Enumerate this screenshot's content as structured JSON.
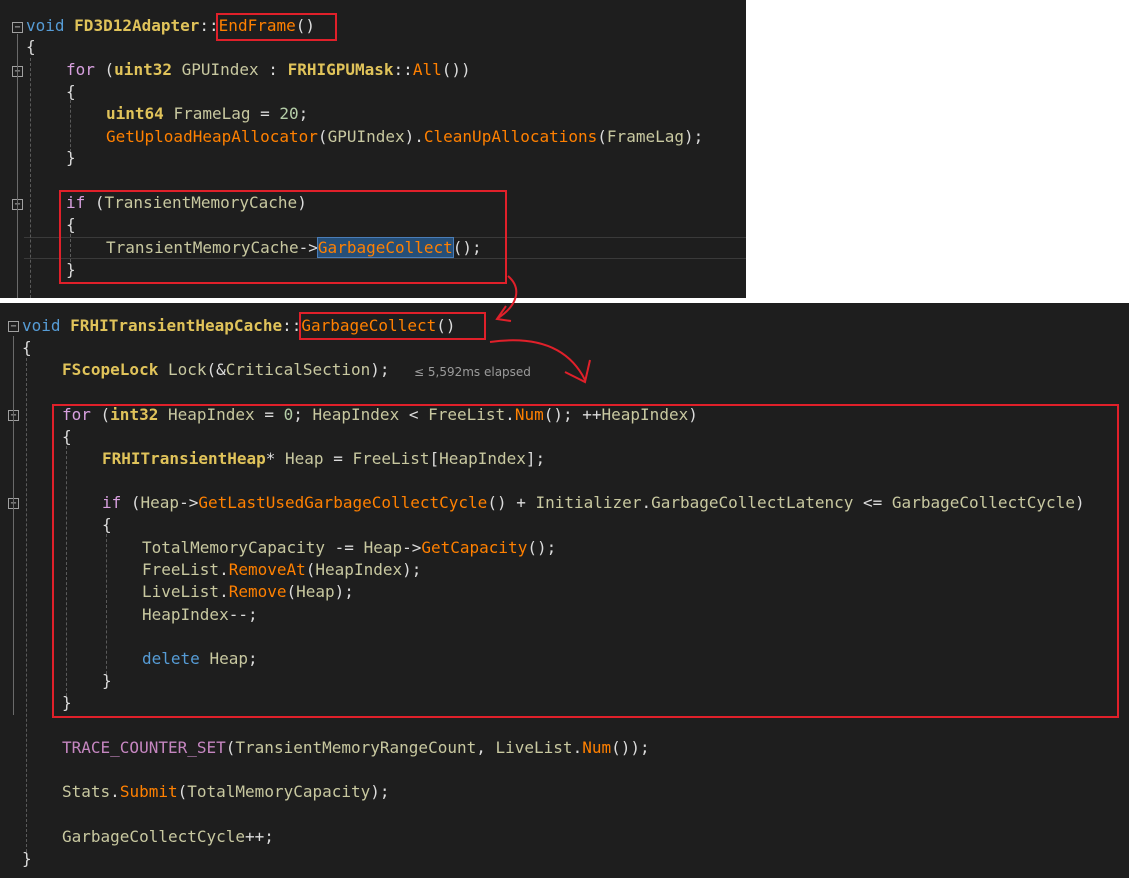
{
  "top": {
    "lines": [
      {
        "parts": [
          [
            "kw",
            "void"
          ],
          [
            "pun",
            " "
          ],
          [
            "ty",
            "FD3D12Adapter"
          ],
          [
            "pun",
            "::"
          ],
          [
            "fn",
            "EndFrame"
          ],
          [
            "pun",
            "()"
          ]
        ]
      },
      {
        "parts": [
          [
            "pun",
            "{"
          ]
        ]
      },
      {
        "parts": [
          [
            "ctl",
            "for"
          ],
          [
            "pun",
            " ("
          ],
          [
            "ty",
            "uint32"
          ],
          [
            "pun",
            " "
          ],
          [
            "var",
            "GPUIndex"
          ],
          [
            "pun",
            " : "
          ],
          [
            "ty",
            "FRHIGPUMask"
          ],
          [
            "pun",
            "::"
          ],
          [
            "fn",
            "All"
          ],
          [
            "pun",
            "())"
          ]
        ]
      },
      {
        "parts": [
          [
            "pun",
            "{"
          ]
        ]
      },
      {
        "parts": [
          [
            "ty",
            "uint64"
          ],
          [
            "pun",
            " "
          ],
          [
            "var",
            "FrameLag"
          ],
          [
            "pun",
            " = "
          ],
          [
            "num",
            "20"
          ],
          [
            "pun",
            ";"
          ]
        ]
      },
      {
        "parts": [
          [
            "fn",
            "GetUploadHeapAllocator"
          ],
          [
            "pun",
            "("
          ],
          [
            "var",
            "GPUIndex"
          ],
          [
            "pun",
            ")."
          ],
          [
            "fn",
            "CleanUpAllocations"
          ],
          [
            "pun",
            "("
          ],
          [
            "var",
            "FrameLag"
          ],
          [
            "pun",
            ");"
          ]
        ]
      },
      {
        "parts": [
          [
            "pun",
            "}"
          ]
        ]
      },
      {
        "parts": []
      },
      {
        "parts": [
          [
            "ctl",
            "if"
          ],
          [
            "pun",
            " ("
          ],
          [
            "var",
            "TransientMemoryCache"
          ],
          [
            "pun",
            ")"
          ]
        ]
      },
      {
        "parts": [
          [
            "pun",
            "{"
          ]
        ]
      },
      {
        "parts": [
          [
            "var",
            "TransientMemoryCache"
          ],
          [
            "pun",
            "->"
          ],
          [
            "fn hl",
            "GarbageCollect"
          ],
          [
            "pun",
            "();"
          ]
        ]
      },
      {
        "parts": [
          [
            "pun",
            "}"
          ]
        ]
      }
    ]
  },
  "bottom": {
    "hint": "≤ 5,592ms elapsed",
    "lines": [
      {
        "parts": [
          [
            "kw",
            "void"
          ],
          [
            "pun",
            " "
          ],
          [
            "ty",
            "FRHITransientHeapCache"
          ],
          [
            "pun",
            "::"
          ],
          [
            "fn",
            "GarbageCollect"
          ],
          [
            "pun",
            "()"
          ]
        ]
      },
      {
        "parts": [
          [
            "pun",
            "{"
          ]
        ]
      },
      {
        "parts": [
          [
            "ty",
            "FScopeLock"
          ],
          [
            "pun",
            " "
          ],
          [
            "var",
            "Lock"
          ],
          [
            "pun",
            "(&"
          ],
          [
            "var",
            "CriticalSection"
          ],
          [
            "pun",
            ");"
          ]
        ]
      },
      {
        "parts": []
      },
      {
        "parts": [
          [
            "ctl",
            "for"
          ],
          [
            "pun",
            " ("
          ],
          [
            "ty",
            "int32"
          ],
          [
            "pun",
            " "
          ],
          [
            "var",
            "HeapIndex"
          ],
          [
            "pun",
            " = "
          ],
          [
            "num",
            "0"
          ],
          [
            "pun",
            "; "
          ],
          [
            "var",
            "HeapIndex"
          ],
          [
            "pun",
            " < "
          ],
          [
            "var",
            "FreeList"
          ],
          [
            "pun",
            "."
          ],
          [
            "fn",
            "Num"
          ],
          [
            "pun",
            "(); ++"
          ],
          [
            "var",
            "HeapIndex"
          ],
          [
            "pun",
            ")"
          ]
        ]
      },
      {
        "parts": [
          [
            "pun",
            "{"
          ]
        ]
      },
      {
        "parts": [
          [
            "ty",
            "FRHITransientHeap"
          ],
          [
            "pun",
            "* "
          ],
          [
            "var",
            "Heap"
          ],
          [
            "pun",
            " = "
          ],
          [
            "var",
            "FreeList"
          ],
          [
            "pun",
            "["
          ],
          [
            "var",
            "HeapIndex"
          ],
          [
            "pun",
            "];"
          ]
        ]
      },
      {
        "parts": []
      },
      {
        "parts": [
          [
            "ctl",
            "if"
          ],
          [
            "pun",
            " ("
          ],
          [
            "var",
            "Heap"
          ],
          [
            "pun",
            "->"
          ],
          [
            "fn",
            "GetLastUsedGarbageCollectCycle"
          ],
          [
            "pun",
            "() + "
          ],
          [
            "var",
            "Initializer"
          ],
          [
            "pun",
            "."
          ],
          [
            "var",
            "GarbageCollectLatency"
          ],
          [
            "pun",
            " <= "
          ],
          [
            "var",
            "GarbageCollectCycle"
          ],
          [
            "pun",
            ")"
          ]
        ]
      },
      {
        "parts": [
          [
            "pun",
            "{"
          ]
        ]
      },
      {
        "parts": [
          [
            "var",
            "TotalMemoryCapacity"
          ],
          [
            "pun",
            " -= "
          ],
          [
            "var",
            "Heap"
          ],
          [
            "pun",
            "->"
          ],
          [
            "fn",
            "GetCapacity"
          ],
          [
            "pun",
            "();"
          ]
        ]
      },
      {
        "parts": [
          [
            "var",
            "FreeList"
          ],
          [
            "pun",
            "."
          ],
          [
            "fn",
            "RemoveAt"
          ],
          [
            "pun",
            "("
          ],
          [
            "var",
            "HeapIndex"
          ],
          [
            "pun",
            ");"
          ]
        ]
      },
      {
        "parts": [
          [
            "var",
            "LiveList"
          ],
          [
            "pun",
            "."
          ],
          [
            "fn",
            "Remove"
          ],
          [
            "pun",
            "("
          ],
          [
            "var",
            "Heap"
          ],
          [
            "pun",
            ");"
          ]
        ]
      },
      {
        "parts": [
          [
            "var",
            "HeapIndex"
          ],
          [
            "pun",
            "--;"
          ]
        ]
      },
      {
        "parts": []
      },
      {
        "parts": [
          [
            "kw",
            "delete"
          ],
          [
            "pun",
            " "
          ],
          [
            "var",
            "Heap"
          ],
          [
            "pun",
            ";"
          ]
        ]
      },
      {
        "parts": [
          [
            "pun",
            "}"
          ]
        ]
      },
      {
        "parts": [
          [
            "pun",
            "}"
          ]
        ]
      },
      {
        "parts": []
      },
      {
        "parts": [
          [
            "macro",
            "TRACE_COUNTER_SET"
          ],
          [
            "pun",
            "("
          ],
          [
            "var",
            "TransientMemoryRangeCount"
          ],
          [
            "pun",
            ", "
          ],
          [
            "var",
            "LiveList"
          ],
          [
            "pun",
            "."
          ],
          [
            "fn",
            "Num"
          ],
          [
            "pun",
            "());"
          ]
        ]
      },
      {
        "parts": []
      },
      {
        "parts": [
          [
            "var",
            "Stats"
          ],
          [
            "pun",
            "."
          ],
          [
            "fn",
            "Submit"
          ],
          [
            "pun",
            "("
          ],
          [
            "var",
            "TotalMemoryCapacity"
          ],
          [
            "pun",
            ");"
          ]
        ]
      },
      {
        "parts": []
      },
      {
        "parts": [
          [
            "var",
            "GarbageCollectCycle"
          ],
          [
            "pun",
            "++;"
          ]
        ]
      },
      {
        "parts": [
          [
            "pun",
            "}"
          ]
        ]
      }
    ]
  },
  "colors": {
    "annotation": "#e0202a",
    "background": "#1e1e1e"
  }
}
